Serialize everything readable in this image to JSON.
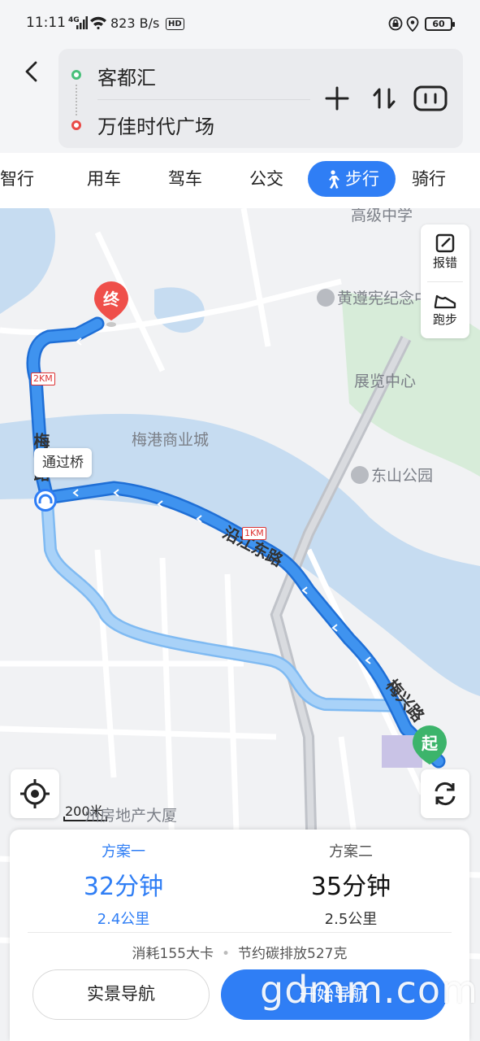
{
  "status_bar": {
    "time": "11:11",
    "network": "4G",
    "speed": "823 B/s",
    "hd": "HD",
    "battery": "60"
  },
  "route": {
    "origin": "客都汇",
    "destination": "万佳时代广场"
  },
  "tabs": [
    {
      "label": "智行",
      "active": false
    },
    {
      "label": "用车",
      "active": false
    },
    {
      "label": "驾车",
      "active": false
    },
    {
      "label": "公交",
      "active": false
    },
    {
      "label": "步行",
      "active": true
    },
    {
      "label": "骑行",
      "active": false
    }
  ],
  "map": {
    "pois": {
      "school": "高级中学",
      "memorial": "黄遵宪纪念中",
      "exhibition": "展览中心",
      "mall": "梅港商业城",
      "park": "东山公园",
      "building": "州房地产大厦"
    },
    "roads": {
      "river_road": "沿江东路",
      "road_west": "梅江路",
      "road_east": "梅兴路"
    },
    "km_markers": {
      "two": "2KM",
      "one": "1KM"
    },
    "bridge_tip": "通过桥",
    "end_pin": "终",
    "start_pin": "起",
    "scale": "200米",
    "tools": {
      "report": "报错",
      "run": "跑步"
    },
    "colors": {
      "river": "#c6dcf1",
      "route_active": "#3f93ef",
      "route_alt": "#a9d2f8",
      "park": "#d7ecd9"
    }
  },
  "plans": [
    {
      "name": "方案一",
      "duration": "32分钟",
      "distance": "2.4公里",
      "active": true
    },
    {
      "name": "方案二",
      "duration": "35分钟",
      "distance": "2.5公里",
      "active": false
    }
  ],
  "energy": {
    "calories": "消耗155大卡",
    "carbon": "节约碳排放527克"
  },
  "actions": {
    "live_nav": "实景导航",
    "start_nav": "开始导航"
  },
  "watermark": "gdmm.com"
}
